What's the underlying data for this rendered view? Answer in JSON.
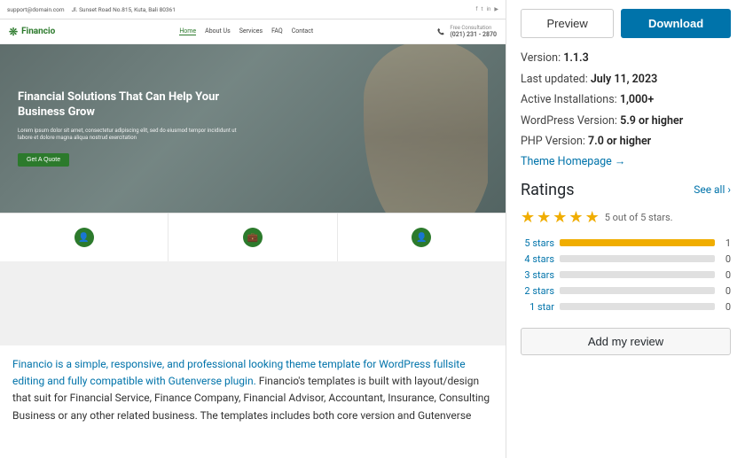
{
  "left": {
    "theme_header": {
      "email": "support@domain.com",
      "address": "Jl. Sunset Road No.815, Kuta, Bali 80361"
    },
    "nav": {
      "logo": "Financio",
      "links": [
        "Home",
        "About Us",
        "Services",
        "FAQ",
        "Contact"
      ],
      "active_link": "Home",
      "consultation_label": "Free Consultation",
      "phone": "(021) 231 - 2870"
    },
    "hero": {
      "title": "Financial Solutions That Can Help Your Business Grow",
      "description": "Lorem ipsum dolor sit amet, consectetur adipiscing elit, sed do eiusmod tempor incididunt ut labore et dolore magna aliqua nostrud exercitation",
      "button_label": "Get A Quote"
    },
    "description": "Financio is a simple, responsive, and professional looking theme template for WordPress fullsite editing and fully compatible with Gutenverse plugin. Financio's templates is built with layout/design that suit for Financial Service, Finance Company, Financial Advisor, Accountant, Insurance, Consulting Business or any other related business. The templates includes both core version and Gutenverse"
  },
  "right": {
    "buttons": {
      "preview_label": "Preview",
      "download_label": "Download"
    },
    "meta": {
      "version_label": "Version:",
      "version_value": "1.1.3",
      "last_updated_label": "Last updated:",
      "last_updated_value": "July 11, 2023",
      "active_installs_label": "Active Installations:",
      "active_installs_value": "1,000+",
      "wp_version_label": "WordPress Version:",
      "wp_version_value": "5.9 or higher",
      "php_version_label": "PHP Version:",
      "php_version_value": "7.0 or higher",
      "homepage_label": "Theme Homepage →"
    },
    "ratings": {
      "title": "Ratings",
      "see_all": "See all",
      "summary": "5 out of 5 stars.",
      "stars": 5,
      "bars": [
        {
          "label": "5 stars",
          "count": 1,
          "fill_pct": 100
        },
        {
          "label": "4 stars",
          "count": 0,
          "fill_pct": 0
        },
        {
          "label": "3 stars",
          "count": 0,
          "fill_pct": 0
        },
        {
          "label": "2 stars",
          "count": 0,
          "fill_pct": 0
        },
        {
          "label": "1 star",
          "count": 0,
          "fill_pct": 0
        }
      ],
      "add_review_label": "Add my review"
    }
  }
}
